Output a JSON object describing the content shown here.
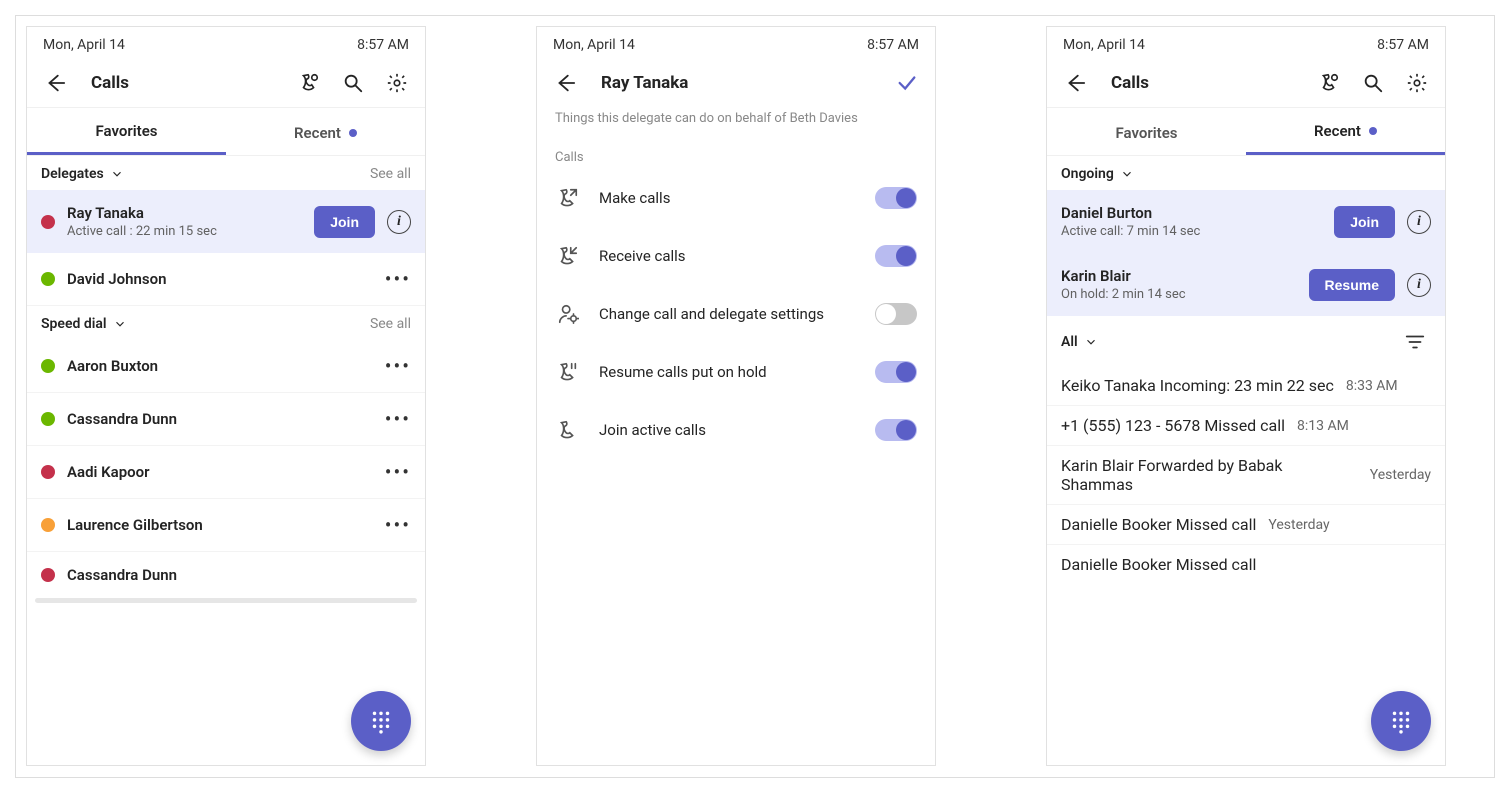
{
  "status": {
    "date": "Mon, April 14",
    "time": "8:57 AM"
  },
  "screenA": {
    "title": "Calls",
    "tab_favorites": "Favorites",
    "tab_recent": "Recent",
    "section_delegates": "Delegates",
    "section_speed_dial": "Speed dial",
    "see_all": "See all",
    "join": "Join",
    "delegates_active": {
      "name": "Ray Tanaka",
      "sub": "Active call : 22 min 15 sec"
    },
    "delegates": [
      {
        "name": "David Johnson",
        "presence": "green"
      }
    ],
    "speed_dial": [
      {
        "name": "Aaron Buxton",
        "presence": "green"
      },
      {
        "name": "Cassandra Dunn",
        "presence": "green"
      },
      {
        "name": "Aadi Kapoor",
        "presence": "red"
      },
      {
        "name": "Laurence Gilbertson",
        "presence": "orange"
      },
      {
        "name": "Cassandra Dunn",
        "presence": "red"
      }
    ]
  },
  "screenB": {
    "title": "Ray Tanaka",
    "subtitle": "Things this delegate can do on behalf of Beth Davies",
    "group": "Calls",
    "permissions": [
      {
        "icon": "call-out",
        "label": "Make calls",
        "on": true
      },
      {
        "icon": "call-in",
        "label": "Receive calls",
        "on": true
      },
      {
        "icon": "person-gear",
        "label": "Change call and delegate settings",
        "on": false
      },
      {
        "icon": "call-hold",
        "label": "Resume calls put on hold",
        "on": true
      },
      {
        "icon": "call",
        "label": "Join active calls",
        "on": true
      }
    ]
  },
  "screenC": {
    "title": "Calls",
    "tab_favorites": "Favorites",
    "tab_recent": "Recent",
    "section_ongoing": "Ongoing",
    "section_all": "All",
    "join": "Join",
    "resume": "Resume",
    "ongoing": [
      {
        "name": "Daniel Burton",
        "sub": "Active call: 7 min 14 sec",
        "action": "Join"
      },
      {
        "name": "Karin Blair",
        "sub": "On hold: 2 min 14 sec",
        "action": "Resume"
      }
    ],
    "recent": [
      {
        "name": "Keiko Tanaka",
        "sub": "Incoming: 23 min 22 sec",
        "time": "8:33 AM",
        "missed": false
      },
      {
        "name": "+1 (555) 123 - 5678",
        "sub": "Missed call",
        "time": "8:13 AM",
        "missed": true
      },
      {
        "name": "Karin Blair",
        "sub": "Forwarded by Babak Shammas",
        "time": "Yesterday",
        "missed": false
      },
      {
        "name": "Danielle Booker",
        "sub": "Missed call",
        "time": "Yesterday",
        "missed": true
      },
      {
        "name": "Danielle Booker",
        "sub": "Missed call",
        "time": "",
        "missed": true
      }
    ]
  }
}
